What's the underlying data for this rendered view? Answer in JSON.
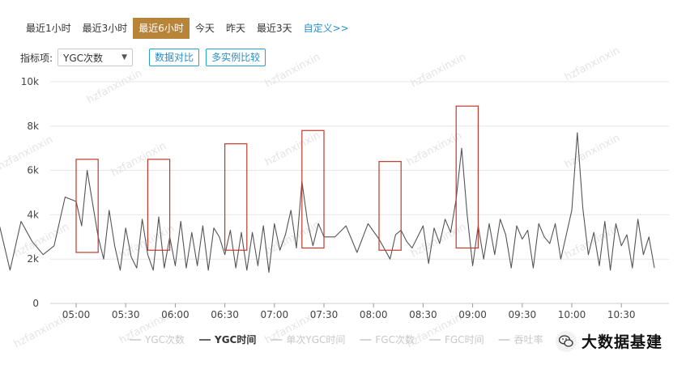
{
  "range_tabs": [
    {
      "label": "最近1小时",
      "active": false
    },
    {
      "label": "最近3小时",
      "active": false
    },
    {
      "label": "最近6小时",
      "active": true
    },
    {
      "label": "今天",
      "active": false
    },
    {
      "label": "昨天",
      "active": false
    },
    {
      "label": "最近3天",
      "active": false
    },
    {
      "label": "自定义>>",
      "active": false
    }
  ],
  "metric_selector": {
    "label": "指标项:",
    "selected": "YGC次数"
  },
  "buttons": {
    "compare_data": "数据对比",
    "compare_instances": "多实例比较"
  },
  "watermark": "hzfanxinxin",
  "corner_brand": {
    "label": "大数据基建",
    "icon": "wechat-icon"
  },
  "colors": {
    "accent_tab": "#b8843a",
    "link": "#2a8ec8",
    "series_line": "#555555",
    "highlight_box": "#c0392b",
    "grid": "#e6e6e6"
  },
  "chart_data": {
    "type": "line",
    "title": "",
    "xlabel": "",
    "ylabel": "",
    "ylim": [
      0,
      10000
    ],
    "yticks": [
      "10k",
      "8k",
      "6k",
      "4k",
      "2k",
      "0"
    ],
    "xticks": [
      "05:00",
      "05:30",
      "06:00",
      "06:30",
      "07:00",
      "07:30",
      "08:00",
      "08:30",
      "09:00",
      "09:30",
      "10:00",
      "10:30"
    ],
    "x_range_minutes": [
      -17,
      103
    ],
    "grid": true,
    "legend_position": "bottom",
    "legend": [
      {
        "name": "YGC次数",
        "active": false
      },
      {
        "name": "YGC时间",
        "active": true
      },
      {
        "name": "单次YGC时间",
        "active": false
      },
      {
        "name": "FGC次数",
        "active": false
      },
      {
        "name": "FGC时间",
        "active": false
      },
      {
        "name": "吞吐率",
        "active": false
      }
    ],
    "series": [
      {
        "name": "YGC时间",
        "points": [
          [
            -16,
            3300
          ],
          [
            -14,
            3600
          ],
          [
            -12,
            1500
          ],
          [
            -10,
            3700
          ],
          [
            -8,
            2800
          ],
          [
            -6,
            2200
          ],
          [
            -4,
            2600
          ],
          [
            -2,
            4800
          ],
          [
            0,
            4600
          ],
          [
            1,
            3500
          ],
          [
            2,
            6000
          ],
          [
            4,
            3000
          ],
          [
            5,
            2000
          ],
          [
            6,
            4200
          ],
          [
            7,
            2600
          ],
          [
            8,
            1500
          ],
          [
            9,
            3400
          ],
          [
            10,
            2100
          ],
          [
            11,
            1600
          ],
          [
            12,
            3800
          ],
          [
            13,
            2200
          ],
          [
            14,
            1500
          ],
          [
            15,
            3900
          ],
          [
            16,
            1600
          ],
          [
            17,
            3000
          ],
          [
            18,
            1700
          ],
          [
            19,
            3700
          ],
          [
            20,
            1600
          ],
          [
            21,
            3200
          ],
          [
            22,
            1700
          ],
          [
            23,
            3500
          ],
          [
            24,
            1500
          ],
          [
            25,
            3400
          ],
          [
            26,
            3000
          ],
          [
            27,
            2200
          ],
          [
            28,
            3300
          ],
          [
            29,
            1600
          ],
          [
            30,
            3200
          ],
          [
            31,
            1500
          ],
          [
            32,
            3200
          ],
          [
            33,
            1700
          ],
          [
            34,
            3500
          ],
          [
            35,
            1400
          ],
          [
            36,
            3600
          ],
          [
            37,
            2400
          ],
          [
            38,
            3100
          ],
          [
            39,
            4200
          ],
          [
            40,
            2500
          ],
          [
            41,
            5500
          ],
          [
            42,
            3700
          ],
          [
            43,
            2600
          ],
          [
            44,
            3600
          ],
          [
            45,
            3000
          ],
          [
            47,
            3000
          ],
          [
            49,
            3500
          ],
          [
            51,
            2300
          ],
          [
            53,
            3600
          ],
          [
            55,
            2900
          ],
          [
            57,
            2000
          ],
          [
            58,
            3100
          ],
          [
            59,
            3300
          ],
          [
            60,
            2800
          ],
          [
            61,
            2500
          ],
          [
            63,
            3500
          ],
          [
            64,
            1800
          ],
          [
            65,
            3400
          ],
          [
            66,
            2700
          ],
          [
            67,
            3800
          ],
          [
            68,
            3200
          ],
          [
            69,
            4700
          ],
          [
            70,
            7000
          ],
          [
            71,
            4000
          ],
          [
            72,
            1700
          ],
          [
            73,
            3500
          ],
          [
            74,
            2000
          ],
          [
            75,
            3600
          ],
          [
            76,
            2200
          ],
          [
            77,
            3800
          ],
          [
            78,
            3100
          ],
          [
            79,
            1600
          ],
          [
            80,
            3500
          ],
          [
            81,
            2900
          ],
          [
            82,
            3300
          ],
          [
            83,
            1600
          ],
          [
            84,
            3600
          ],
          [
            85,
            3000
          ],
          [
            86,
            2700
          ],
          [
            87,
            3600
          ],
          [
            88,
            2000
          ],
          [
            89,
            3100
          ],
          [
            90,
            4200
          ],
          [
            91,
            7700
          ],
          [
            92,
            4300
          ],
          [
            93,
            2200
          ],
          [
            94,
            3200
          ],
          [
            95,
            1700
          ],
          [
            96,
            3700
          ],
          [
            97,
            1500
          ],
          [
            98,
            3600
          ],
          [
            99,
            2600
          ],
          [
            100,
            3100
          ],
          [
            101,
            1600
          ],
          [
            102,
            3800
          ],
          [
            103,
            2200
          ],
          [
            104,
            3000
          ],
          [
            105,
            1600
          ]
        ]
      }
    ],
    "highlight_boxes": [
      {
        "x_from": 0,
        "x_to": 4,
        "y_from": 2300,
        "y_to": 6500
      },
      {
        "x_from": 13,
        "x_to": 17,
        "y_from": 2400,
        "y_to": 6500
      },
      {
        "x_from": 27,
        "x_to": 31,
        "y_from": 2400,
        "y_to": 7200
      },
      {
        "x_from": 41,
        "x_to": 45,
        "y_from": 2500,
        "y_to": 7800
      },
      {
        "x_from": 55,
        "x_to": 59,
        "y_from": 2400,
        "y_to": 6400
      },
      {
        "x_from": 69,
        "x_to": 73,
        "y_from": 2500,
        "y_to": 8900
      }
    ]
  }
}
